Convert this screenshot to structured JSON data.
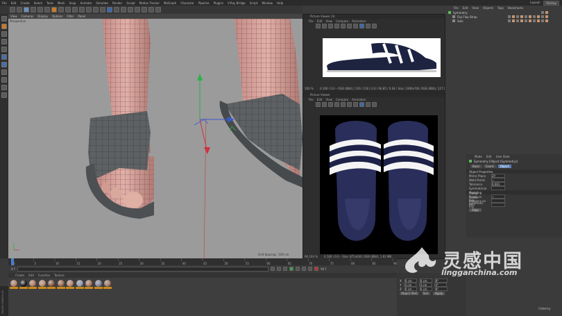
{
  "menubar": {
    "items": [
      "File",
      "Edit",
      "Create",
      "Select",
      "Tools",
      "Mesh",
      "Snap",
      "Animate",
      "Simulate",
      "Render",
      "Sculpt",
      "Motion Tracker",
      "MoGraph",
      "Character",
      "Pipeline",
      "Plugins",
      "V-Ray Bridge",
      "Script",
      "Window",
      "Help"
    ],
    "layout_label": "Layout:",
    "layout_value": "Startup"
  },
  "viewport": {
    "menu": [
      "View",
      "Cameras",
      "Display",
      "Options",
      "Filter",
      "Panel"
    ],
    "label": "Perspective",
    "grid_spacing": "Grid Spacing : 100 cm"
  },
  "picture_viewer_1": {
    "title": "Picture Viewer (3)",
    "menu": [
      "File",
      "Edit",
      "View",
      "Compare",
      "Animation"
    ],
    "footer_zoom": "100 %",
    "footer_info": "0.100 / 0.0 – RGB (8Bit) / 226 / 216 / 0.0 / 96.85 / 0.04 / Size: 1900x700, RGB (8Bit), 127.12 kB"
  },
  "picture_viewer_2": {
    "title": "Picture Viewer",
    "menu": [
      "File",
      "Edit",
      "View",
      "Compare",
      "Animation"
    ],
    "footer_zoom": "66.104 %",
    "footer_info": "0.100 / 0.0 – Size: 871x630, RGB (8Bit), 1.63 MB"
  },
  "object_manager": {
    "menu": [
      "File",
      "Edit",
      "View",
      "Objects",
      "Tags",
      "Bookmarks"
    ],
    "objects": [
      {
        "name": "Symmetry",
        "color": "#5fb85f"
      },
      {
        "name": "Flip Flop Strap"
      },
      {
        "name": "Sole"
      }
    ]
  },
  "attributes": {
    "menu": [
      "Mode",
      "Edit",
      "User Data"
    ],
    "object_label": "Symmetry [Object (Symmetry)]",
    "tabs": [
      "Basic",
      "Coord.",
      "Object"
    ],
    "active_tab": "Object",
    "section": "Object Properties",
    "rows": [
      {
        "label": "Mirror Plane",
        "value": "ZY"
      },
      {
        "label": "Weld Points",
        "value": "✓"
      },
      {
        "label": "Tolerance",
        "value": "0.001 cm"
      },
      {
        "label": "Symmetrical",
        "value": ""
      }
    ],
    "section2": "Modeling",
    "rows2": [
      {
        "label": "Clamp Points on Axis",
        "value": "✓"
      },
      {
        "label": "Delete Polygons on Axis",
        "value": ""
      },
      {
        "label": "Automatic Flip",
        "value": ""
      }
    ],
    "align_button": "Align"
  },
  "timeline": {
    "ticks": [
      "0",
      "5",
      "10",
      "15",
      "20",
      "25",
      "30",
      "35",
      "40",
      "45",
      "50",
      "55",
      "60",
      "65",
      "70",
      "75",
      "80",
      "85",
      "90"
    ],
    "start_frame": "0 F",
    "end_frame": "90 F"
  },
  "materials": {
    "menu": [
      "Create",
      "Edit",
      "Function",
      "Texture"
    ],
    "items": [
      {
        "name": "Mat",
        "color": "#b8846a"
      },
      {
        "name": "Mat",
        "color": "#1a1a1a"
      },
      {
        "name": "Mat",
        "color": "#b87a60"
      },
      {
        "name": "Mat",
        "color": "#c48e72"
      },
      {
        "name": "Mat",
        "color": "#8a5a44"
      },
      {
        "name": "Mat",
        "color": "#a06a52"
      },
      {
        "name": "Mat",
        "color": "#c08c70"
      },
      {
        "name": "Mat",
        "color": "#9a9ab0"
      },
      {
        "name": "Mat",
        "color": "#b07a62"
      },
      {
        "name": "Mat",
        "color": "#8a8aa0"
      },
      {
        "name": "Mat",
        "color": "#a87a66"
      }
    ]
  },
  "coordinates": {
    "rows": [
      {
        "axis": "X",
        "pos": "0 cm",
        "size": "0 cm",
        "rot": "0°"
      },
      {
        "axis": "Y",
        "pos": "0 cm",
        "size": "0 cm",
        "rot": "0°"
      },
      {
        "axis": "Z",
        "pos": "0 cm",
        "size": "0 cm",
        "rot": "0°"
      }
    ],
    "mode": "Object (Rel)",
    "size_mode": "Size",
    "apply": "Apply"
  },
  "watermark": {
    "cn": "灵感中国",
    "url": "lingganchina.com"
  },
  "udemy_logo": "Udemy",
  "side_label": "MAXON CINEMA 4D"
}
